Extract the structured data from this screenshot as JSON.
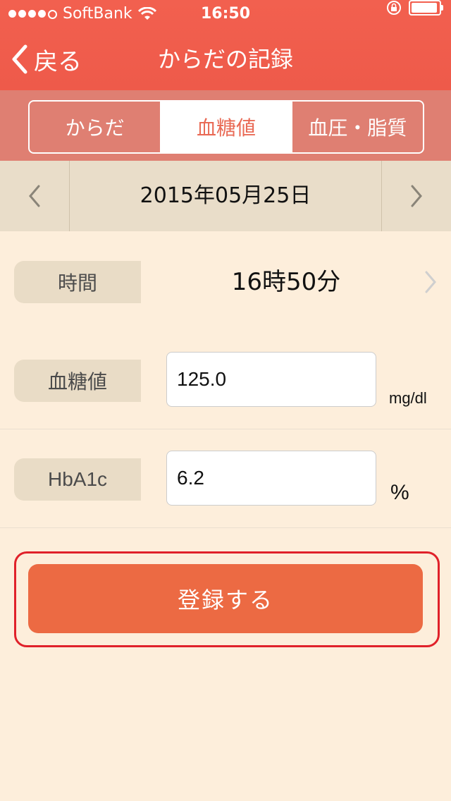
{
  "status_bar": {
    "carrier": "SoftBank",
    "time": "16:50",
    "signal_bars_filled": 4,
    "signal_bars_total": 5
  },
  "nav": {
    "back_label": "戻る",
    "title": "からだの記録"
  },
  "tabs": [
    {
      "label": "からだ",
      "active": false
    },
    {
      "label": "血糖値",
      "active": true
    },
    {
      "label": "血圧・脂質",
      "active": false
    }
  ],
  "date": {
    "label": "2015年05月25日"
  },
  "form": {
    "time_label": "時間",
    "time_value": "16時50分",
    "glucose_label": "血糖値",
    "glucose_value": "125.0",
    "glucose_unit": "mg/dl",
    "hba1c_label": "HbA1c",
    "hba1c_value": "6.2",
    "hba1c_unit": "%"
  },
  "actions": {
    "register_label": "登録する"
  },
  "colors": {
    "header": "#ef5b4b",
    "segment_bg": "#df7f72",
    "active_tab_text": "#e96a55",
    "date_bar": "#e9ddc9",
    "background": "#fdeedb",
    "button": "#ec6a43",
    "highlight": "#e0212a"
  }
}
